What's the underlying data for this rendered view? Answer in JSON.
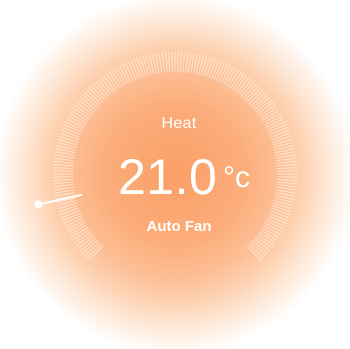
{
  "thermostat": {
    "mode_label": "Heat",
    "temperature": "21.0",
    "unit": "°c",
    "fan_label": "Auto Fan",
    "setpoint_fraction": 0.12
  },
  "colors": {
    "accent": "#fa9f66",
    "text": "#ffffff"
  },
  "icons": {
    "knob": "knob-handle-icon"
  }
}
